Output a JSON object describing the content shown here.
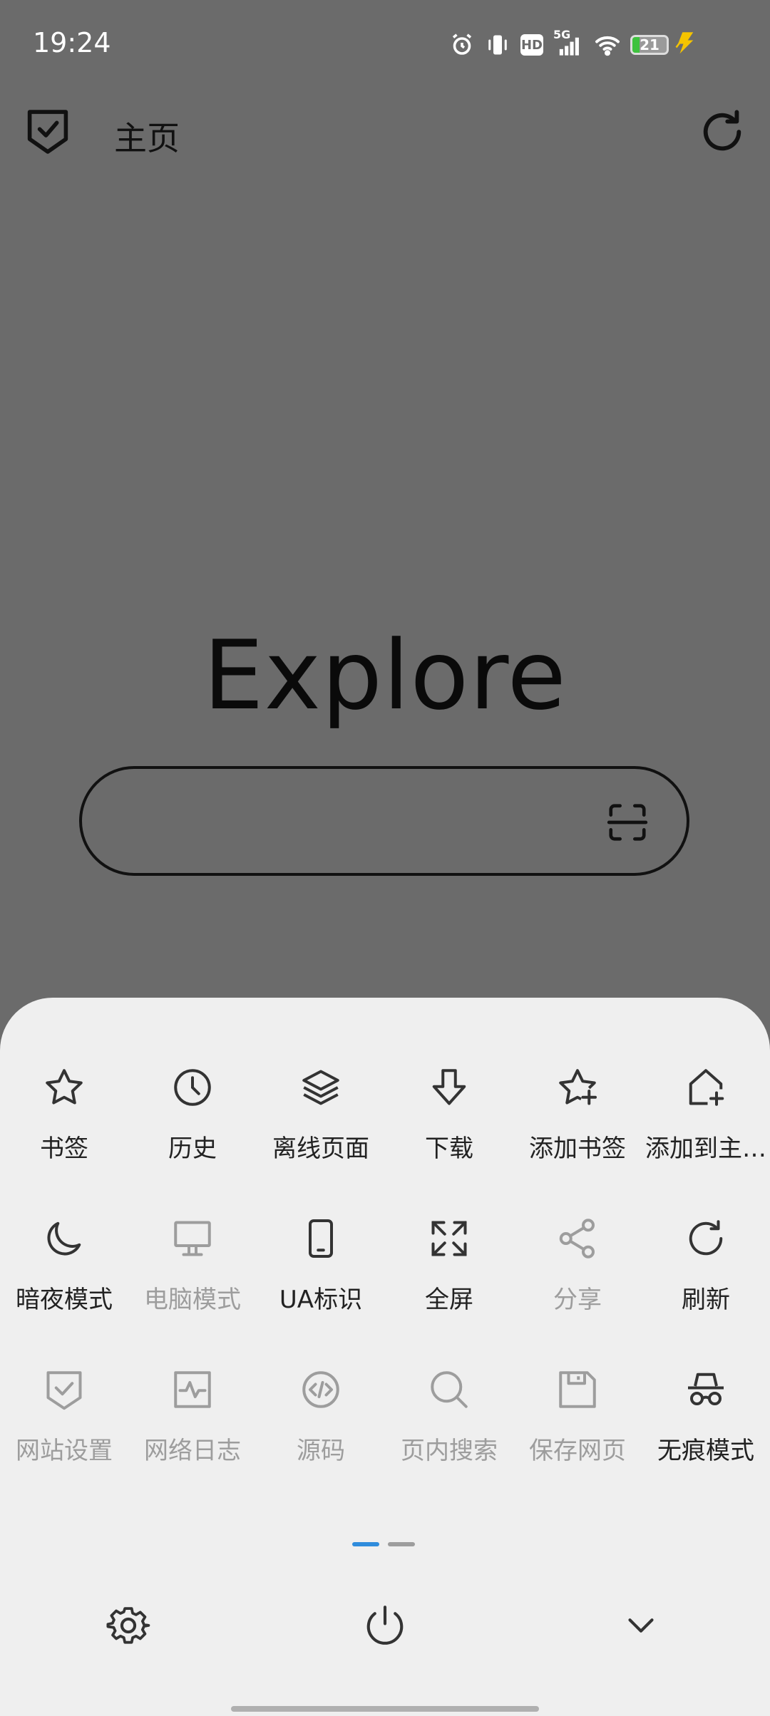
{
  "status_bar": {
    "time": "19:24",
    "network": "5G",
    "hd_badge": "HD",
    "battery_level": "21",
    "battery_fraction": 0.21,
    "icons": [
      "alarm-icon",
      "vibrate-icon",
      "hd-icon",
      "signal-icon",
      "wifi-icon",
      "battery-icon",
      "charging-icon"
    ]
  },
  "header": {
    "title": "主页",
    "left_icon": "shield-check-icon",
    "right_icon": "refresh-icon"
  },
  "explore": {
    "logo": "Explore",
    "search_value": "",
    "search_icon": "scan-icon"
  },
  "menu": {
    "rows": [
      [
        {
          "label": "书签",
          "icon": "star-icon",
          "enabled": true
        },
        {
          "label": "历史",
          "icon": "clock-icon",
          "enabled": true
        },
        {
          "label": "离线页面",
          "icon": "layers-icon",
          "enabled": true
        },
        {
          "label": "下载",
          "icon": "download-icon",
          "enabled": true
        },
        {
          "label": "添加书签",
          "icon": "star-plus-icon",
          "enabled": true
        },
        {
          "label": "添加到主…",
          "icon": "home-plus-icon",
          "enabled": true
        }
      ],
      [
        {
          "label": "暗夜模式",
          "icon": "moon-icon",
          "enabled": true
        },
        {
          "label": "电脑模式",
          "icon": "monitor-icon",
          "enabled": false
        },
        {
          "label": "UA标识",
          "icon": "phone-icon",
          "enabled": true
        },
        {
          "label": "全屏",
          "icon": "fullscreen-icon",
          "enabled": true
        },
        {
          "label": "分享",
          "icon": "share-icon",
          "enabled": false
        },
        {
          "label": "刷新",
          "icon": "refresh-icon",
          "enabled": true
        }
      ],
      [
        {
          "label": "网站设置",
          "icon": "shield-check-icon",
          "enabled": false
        },
        {
          "label": "网络日志",
          "icon": "pulse-icon",
          "enabled": false
        },
        {
          "label": "源码",
          "icon": "code-icon",
          "enabled": false
        },
        {
          "label": "页内搜索",
          "icon": "search-icon",
          "enabled": false
        },
        {
          "label": "保存网页",
          "icon": "save-icon",
          "enabled": false
        },
        {
          "label": "无痕模式",
          "icon": "incognito-icon",
          "enabled": true
        }
      ]
    ],
    "pages_total": 2,
    "page_active": 1
  },
  "bottom_bar": {
    "left_icon": "gear-icon",
    "center_icon": "power-icon",
    "right_icon": "chevron-down-icon"
  },
  "colors": {
    "overlay": "#6b6b6b",
    "sheet": "#efefef",
    "icon_enabled": "#333333",
    "icon_disabled": "#9d9d9d",
    "accent": "#2f8cdc"
  }
}
